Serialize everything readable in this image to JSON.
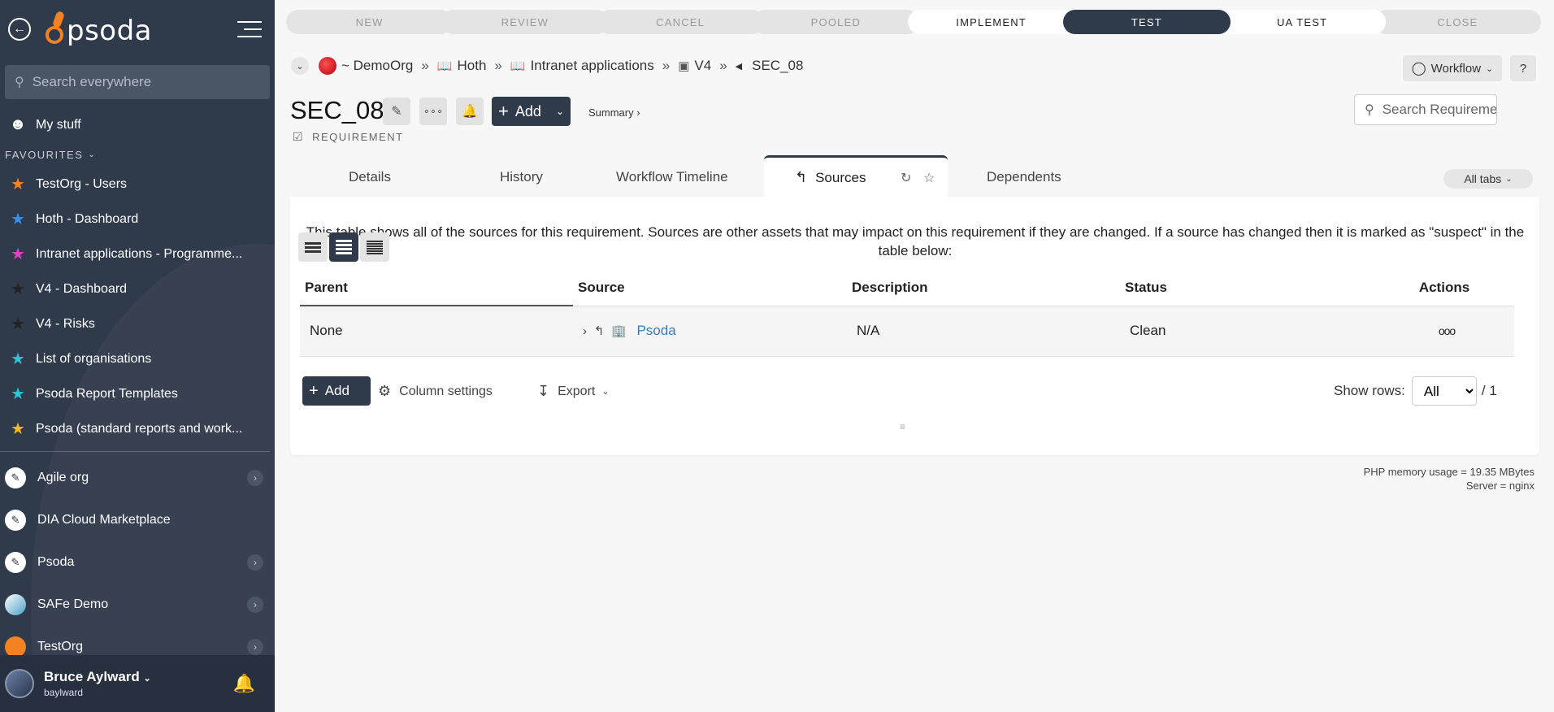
{
  "sidebar": {
    "brand": "psoda",
    "search_placeholder": "Search everywhere",
    "my_stuff": "My stuff",
    "favourites_label": "FAVOURITES",
    "favourites": [
      {
        "label": "TestOrg - Users",
        "color": "#f58220"
      },
      {
        "label": "Hoth - Dashboard",
        "color": "#3b8ee8"
      },
      {
        "label": "Intranet applications - Programme...",
        "color": "#e040c8"
      },
      {
        "label": "V4 - Dashboard",
        "color": "#222222"
      },
      {
        "label": "V4 - Risks",
        "color": "#222222"
      },
      {
        "label": "List of organisations",
        "color": "#2ec4d6"
      },
      {
        "label": "Psoda Report Templates",
        "color": "#2ec4d6"
      },
      {
        "label": "Psoda (standard reports and work...",
        "color": "#f5b820"
      }
    ],
    "orgs": [
      {
        "label": "Agile org",
        "has_children": true
      },
      {
        "label": "DIA Cloud Marketplace",
        "has_children": false
      },
      {
        "label": "Psoda",
        "has_children": true
      },
      {
        "label": "SAFe Demo",
        "has_children": true
      },
      {
        "label": "TestOrg",
        "has_children": true
      }
    ],
    "user": {
      "name": "Bruce Aylward",
      "login": "baylward"
    }
  },
  "workflow_steps": [
    {
      "label": "NEW",
      "state": "inactive"
    },
    {
      "label": "REVIEW",
      "state": "inactive"
    },
    {
      "label": "CANCEL",
      "state": "inactive"
    },
    {
      "label": "POOLED",
      "state": "inactive"
    },
    {
      "label": "IMPLEMENT",
      "state": "active"
    },
    {
      "label": "TEST",
      "state": "current"
    },
    {
      "label": "UA TEST",
      "state": "active"
    },
    {
      "label": "CLOSE",
      "state": "inactive"
    }
  ],
  "breadcrumb": {
    "org": "~ DemoOrg",
    "items": [
      "Hoth",
      "Intranet applications",
      "V4"
    ],
    "current": "SEC_08",
    "separator": "»"
  },
  "header": {
    "workflow_label": "Workflow",
    "help_label": "?",
    "title": "SEC_08",
    "add_label": "Add",
    "summary_label": "Summary ›",
    "type_label": "REQUIREMENT",
    "search_placeholder": "Search Requirements"
  },
  "tabs": {
    "details": "Details",
    "history": "History",
    "workflow_timeline": "Workflow Timeline",
    "sources": "Sources",
    "dependents": "Dependents",
    "all_tabs": "All tabs"
  },
  "panel": {
    "intro": "This table shows all of the sources for this requirement. Sources are other assets that may impact on this requirement if they are changed. If a source has changed then it is marked as \"suspect\" in the table below:",
    "columns": {
      "parent": "Parent",
      "source": "Source",
      "description": "Description",
      "status": "Status",
      "actions": "Actions"
    },
    "rows": [
      {
        "parent": "None",
        "source": "Psoda",
        "description": "N/A",
        "status": "Clean",
        "actions": "ooo"
      }
    ],
    "add_label": "Add",
    "column_settings_label": "Column settings",
    "export_label": "Export",
    "show_rows_label": "Show rows:",
    "show_rows_value": "All",
    "page_total": "/ 1"
  },
  "footer": {
    "memory": "PHP memory usage = 19.35 MBytes",
    "server": "Server = nginx"
  },
  "colors": {
    "sidebar_bg": "#2f3a4b",
    "accent_orange": "#f58220",
    "status_clean": "#2ecc40",
    "link": "#3a7ab8"
  }
}
